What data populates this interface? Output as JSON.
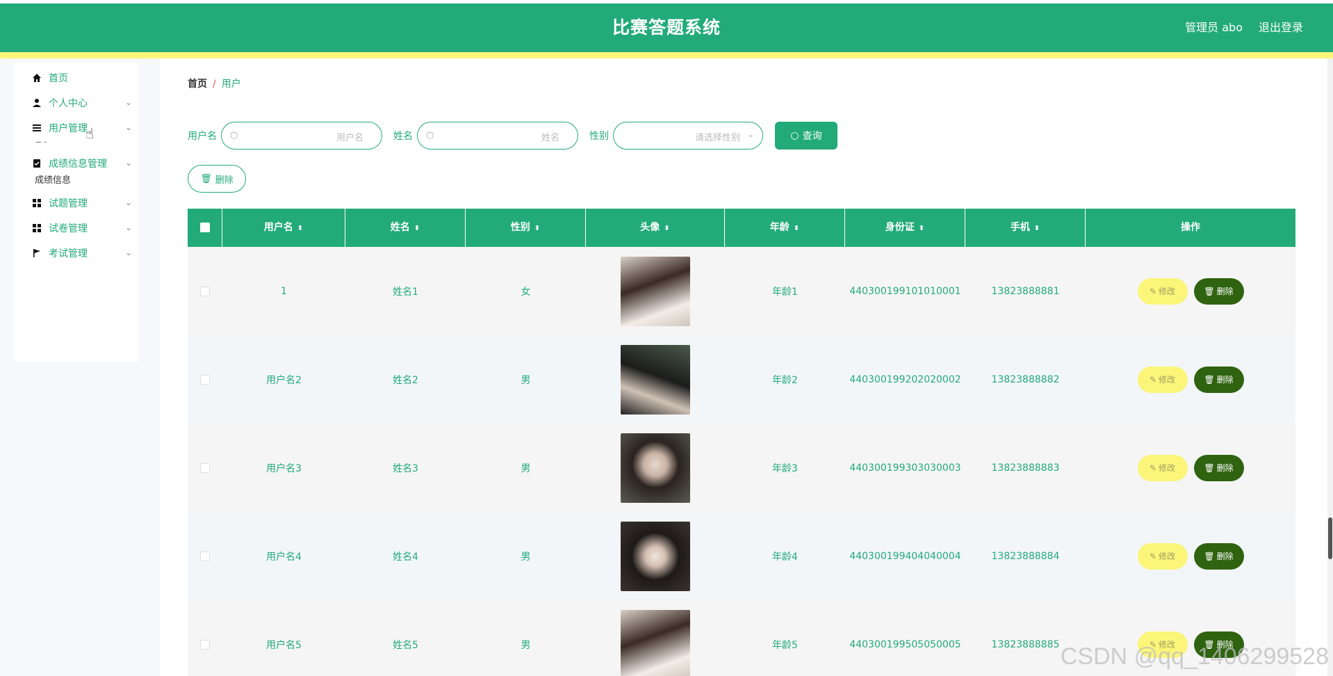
{
  "header": {
    "title": "比赛答题系统",
    "admin_label": "管理员 abo",
    "logout_label": "退出登录"
  },
  "sidebar": {
    "items": [
      {
        "label": "首页",
        "icon": "home-icon"
      },
      {
        "label": "个人中心",
        "icon": "user-icon"
      },
      {
        "label": "用户管理",
        "icon": "list-icon"
      },
      {
        "label": "成绩信息管理",
        "icon": "clipboard-check-icon"
      },
      {
        "label": "试题管理",
        "icon": "grid-icon"
      },
      {
        "label": "试卷管理",
        "icon": "grid-icon"
      },
      {
        "label": "考试管理",
        "icon": "flag-icon"
      }
    ],
    "submenu_label": "成绩信息",
    "submenu_peek": "用户"
  },
  "breadcrumb": {
    "home": "首页",
    "separator": "/",
    "current": "用户"
  },
  "filters": {
    "username_label": "用户名",
    "username_placeholder": "用户名",
    "name_label": "姓名",
    "name_placeholder": "姓名",
    "gender_label": "性别",
    "gender_placeholder": "请选择性别",
    "query_label": "查询",
    "bulk_delete_label": "删除"
  },
  "table": {
    "columns": [
      "用户名",
      "姓名",
      "性别",
      "头像",
      "年龄",
      "身份证",
      "手机",
      "操作"
    ],
    "rows": [
      {
        "username": "1",
        "name": "姓名1",
        "gender": "女",
        "age": "年龄1",
        "id_card": "440300199101010001",
        "phone": "13823888881"
      },
      {
        "username": "用户名2",
        "name": "姓名2",
        "gender": "男",
        "age": "年龄2",
        "id_card": "440300199202020002",
        "phone": "13823888882"
      },
      {
        "username": "用户名3",
        "name": "姓名3",
        "gender": "男",
        "age": "年龄3",
        "id_card": "440300199303030003",
        "phone": "13823888883"
      },
      {
        "username": "用户名4",
        "name": "姓名4",
        "gender": "男",
        "age": "年龄4",
        "id_card": "440300199404040004",
        "phone": "13823888884"
      },
      {
        "username": "用户名5",
        "name": "姓名5",
        "gender": "男",
        "age": "年龄5",
        "id_card": "440300199505050005",
        "phone": "13823888885"
      }
    ],
    "edit_label": "修改",
    "delete_label": "删除"
  },
  "watermark": "CSDN @qq_1406299528",
  "colors": {
    "primary": "#22aa7a",
    "accent_yellow": "#fbf57a",
    "delete_dark": "#2f6310"
  }
}
